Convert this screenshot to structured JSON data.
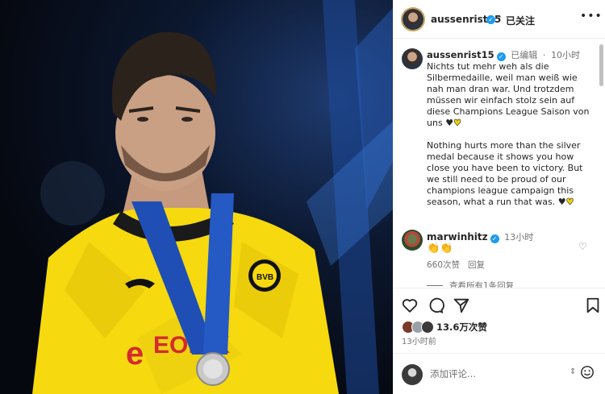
{
  "post": {
    "author": "aussenrist15",
    "follow_status": "已关注",
    "more_icon": "more-horizontal-icon"
  },
  "caption": {
    "author": "aussenrist15",
    "edited": "已编辑",
    "separator": "·",
    "time": "10小时",
    "text_de": "Nichts tut mehr weh als die Silbermedaille, weil man weiß wie nah man dran war. Und trotzdem müssen wir einfach stolz sein auf diese Champions League Saison von uns",
    "text_en": "Nothing hurts more than the silver medal because it shows you how close you have been to victory. But we still need to be proud of our champions league campaign this season, what a run that was."
  },
  "comment": {
    "author": "marwinhitz",
    "time": "13小时",
    "text": "👏👏",
    "likes": "660次赞",
    "reply": "回复",
    "view_replies": "查看所有1条回复"
  },
  "actions": {
    "likes": "13.6万次赞",
    "time_ago": "13小时前",
    "comment_placeholder": "添加评论..."
  },
  "colors": {
    "verified": "#1d9bf0",
    "jersey_yellow": "#f6d90f",
    "lanyard_blue": "#1f4fb5"
  }
}
